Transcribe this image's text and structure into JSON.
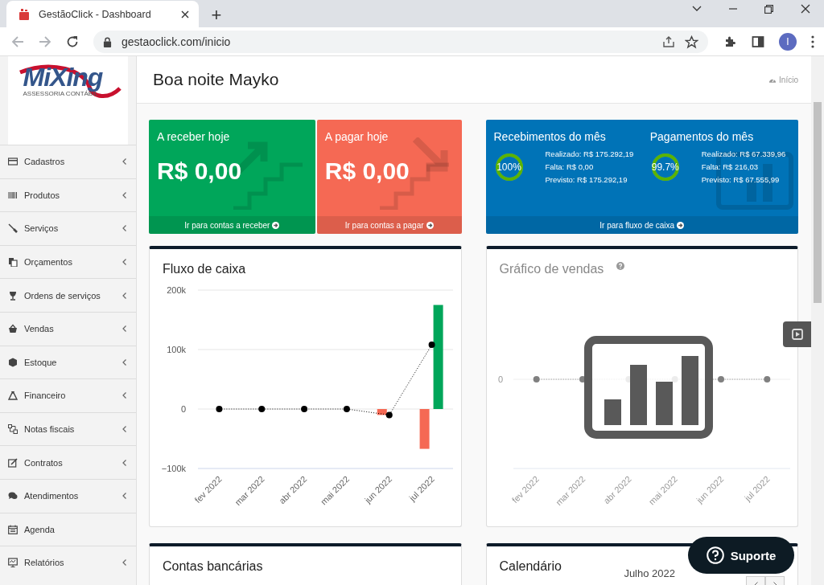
{
  "browser": {
    "tab_title": "GestãoClick - Dashboard",
    "new_tab": "+",
    "url": "gestaoclick.com/inicio",
    "profile_initial": "I"
  },
  "logo": {
    "name": "MiXing",
    "tagline": "ASSESSORIA CONTÁBIL"
  },
  "sidebar": {
    "items": [
      {
        "label": "Cadastros",
        "expandable": true
      },
      {
        "label": "Produtos",
        "expandable": true
      },
      {
        "label": "Serviços",
        "expandable": true
      },
      {
        "label": "Orçamentos",
        "expandable": true
      },
      {
        "label": "Ordens de serviços",
        "expandable": true
      },
      {
        "label": "Vendas",
        "expandable": true
      },
      {
        "label": "Estoque",
        "expandable": true
      },
      {
        "label": "Financeiro",
        "expandable": true
      },
      {
        "label": "Notas fiscais",
        "expandable": true
      },
      {
        "label": "Contratos",
        "expandable": true
      },
      {
        "label": "Atendimentos",
        "expandable": true
      },
      {
        "label": "Agenda",
        "expandable": false
      },
      {
        "label": "Relatórios",
        "expandable": true
      }
    ]
  },
  "header": {
    "greeting": "Boa noite Mayko",
    "breadcrumb": "Início"
  },
  "cards": [
    {
      "kind": "receivable",
      "title": "A receber hoje",
      "value": "R$ 0,00",
      "link": "Ir para contas a receber"
    },
    {
      "kind": "payable",
      "title": "A pagar hoje",
      "value": "R$ 0,00",
      "link": "Ir para contas a pagar"
    }
  ],
  "monthly": {
    "link": "Ir para fluxo de caixa",
    "sections": [
      {
        "title": "Recebimentos do mês",
        "level": 1,
        "percent": "100%",
        "lines": [
          "Realizado: R$ 175.292,19",
          "Falta: R$ 0,00",
          "Previsto: R$ 175.292,19"
        ]
      },
      {
        "title": "Pagamentos do mês",
        "level": 0.997,
        "percent": "99.7%",
        "lines": [
          "Realizado: R$ 67.339,96",
          "Falta: R$ 216,03",
          "Previsto: R$ 67.555,99"
        ]
      }
    ]
  },
  "cash_flow": {
    "title": "Fluxo de caixa",
    "chart_data": {
      "type": "bar",
      "categories": [
        "fev 2022",
        "mar 2022",
        "abr 2022",
        "mai 2022",
        "jun 2022",
        "jul 2022"
      ],
      "ylim": [
        -100000,
        200000
      ],
      "yticks": [
        {
          "value": -100000,
          "label": "−100k"
        },
        {
          "value": 0,
          "label": "0"
        },
        {
          "value": 100000,
          "label": "100k"
        },
        {
          "value": 200000,
          "label": "200k"
        }
      ],
      "series": [
        {
          "color": "#00a65a",
          "type": "bar",
          "values": [
            0,
            0,
            0,
            0,
            0,
            175000
          ]
        },
        {
          "color": "#f56954",
          "type": "bar",
          "values": [
            0,
            0,
            0,
            0,
            -10000,
            -67000
          ]
        },
        {
          "color": "#000000",
          "type": "line",
          "line_style": "dotted",
          "marker": "circle",
          "values": [
            0,
            0,
            0,
            0,
            -10000,
            108000
          ]
        }
      ],
      "stacked": false
    }
  },
  "sales": {
    "title": "Gráfico de vendas",
    "baseline_label": "0",
    "month_labels": [
      "fev 2022",
      "mar 2022",
      "abr 2022",
      "mai 2022",
      "jun 2022",
      "jul 2022"
    ]
  },
  "bottom_panels": [
    {
      "title": "Contas bancárias"
    },
    {
      "title": "Calendário",
      "month": "Julho 2022"
    }
  ],
  "support_button": "Suporte"
}
